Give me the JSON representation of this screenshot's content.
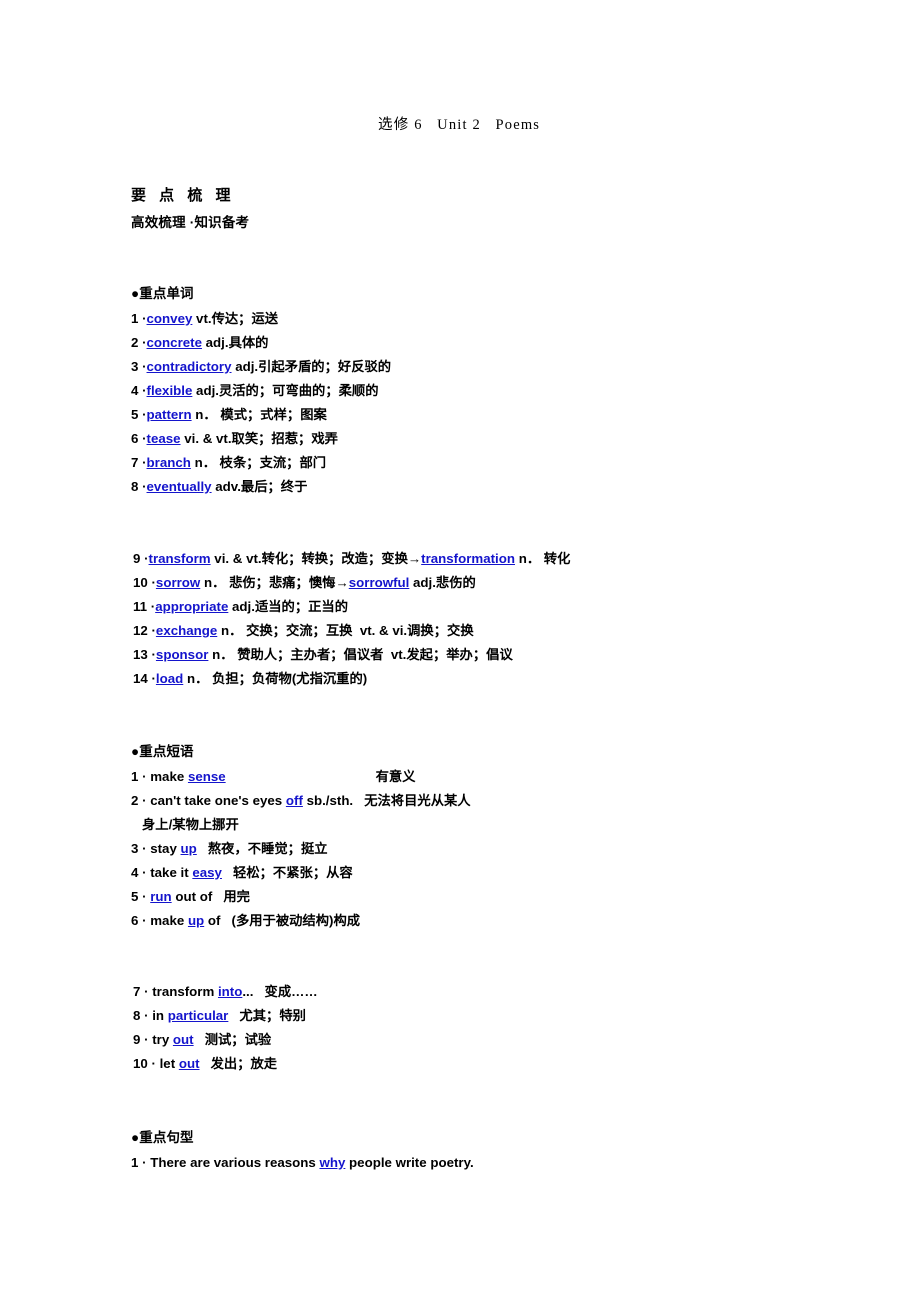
{
  "header": {
    "running_head": "选修 6   Unit 2   Poems"
  },
  "title": {
    "main": "要 点 梳 理",
    "sub": "高效梳理 ·知识备考"
  },
  "sections": {
    "words_heading": "●重点单词",
    "phrases_heading": "●重点短语",
    "patterns_heading": "●重点句型"
  },
  "words": [
    {
      "num": "1 ·",
      "kw": "convey",
      "rest": " vt.传达；运送"
    },
    {
      "num": "2 ·",
      "kw": "concrete",
      "rest": " adj.具体的"
    },
    {
      "num": "3 ·",
      "kw": "contradictory",
      "rest": " adj.引起矛盾的；好反驳的"
    },
    {
      "num": "4 ·",
      "kw": "flexible",
      "rest": " adj.灵活的；可弯曲的；柔顺的"
    },
    {
      "num": "5 ·",
      "kw": "pattern",
      "rest": " n． 模式；式样；图案"
    },
    {
      "num": "6 ·",
      "kw": "tease",
      "rest": " vi. & vt.取笑；招惹；戏弄"
    },
    {
      "num": "7 ·",
      "kw": "branch",
      "rest": " n． 枝条；支流；部门"
    },
    {
      "num": "8 ·",
      "kw": "eventually",
      "rest": " adv.最后；终于"
    },
    {
      "num": "9 ·",
      "kw": "transform",
      "mid": " vi. & vt.转化；转换；改造；变换→",
      "kw2": "transformation",
      "rest": " n． 转化"
    },
    {
      "num": "10 ·",
      "kw": "sorrow",
      "mid": " n． 悲伤；悲痛；懊悔→",
      "kw2": "sorrowful",
      "rest": " adj.悲伤的"
    },
    {
      "num": "11 ·",
      "kw": "appropriate",
      "rest": " adj.适当的；正当的"
    },
    {
      "num": "12 ·",
      "kw": "exchange",
      "rest": " n． 交换；交流；互换  vt. & vi.调换；交换"
    },
    {
      "num": "13 ·",
      "kw": "sponsor",
      "rest": " n． 赞助人；主办者；倡议者  vt.发起；举办；倡议"
    },
    {
      "num": "14 ·",
      "kw": "load",
      "rest": " n． 负担；负荷物(尤指沉重的)"
    }
  ],
  "phrases": [
    {
      "num": "1 ·",
      "pre": " make ",
      "kw": "sense",
      "gap": true,
      "rest": "有意义"
    },
    {
      "num": "2 ·",
      "pre": " can't take one's eyes ",
      "kw": "off",
      "rest": " sb./sth.   无法将目光从某人",
      "wrap": "身上/某物上挪开"
    },
    {
      "num": "3 ·",
      "pre": " stay ",
      "kw": "up",
      "rest": "   熬夜，不睡觉；挺立"
    },
    {
      "num": "4 ·",
      "pre": " take it ",
      "kw": "easy",
      "rest": "   轻松；不紧张；从容"
    },
    {
      "num": "5 ·",
      "pre": " ",
      "kw": "run",
      "rest": " out of   用完"
    },
    {
      "num": "6 ·",
      "pre": " make ",
      "kw": "up",
      "rest": " of   (多用于被动结构)构成"
    },
    {
      "num": "7 ·",
      "pre": " transform ",
      "kw": "into",
      "rest": "...   变成……"
    },
    {
      "num": "8 ·",
      "pre": " in ",
      "kw": "particular",
      "rest": "   尤其；特别"
    },
    {
      "num": "9 ·",
      "pre": " try ",
      "kw": "out",
      "rest": "   测试；试验"
    },
    {
      "num": "10 ·",
      "pre": " let ",
      "kw": "out",
      "rest": "   发出；放走"
    }
  ],
  "patterns": [
    {
      "num": "1 ·",
      "pre": " There are various reasons ",
      "kw": "why",
      "rest": " people write poetry."
    }
  ]
}
